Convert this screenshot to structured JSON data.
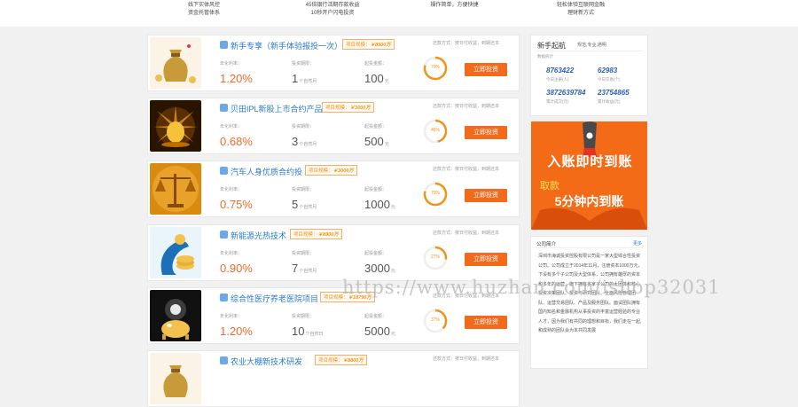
{
  "features": [
    {
      "line1": "线下实体风控",
      "line2": "资金托管体系"
    },
    {
      "line1": "45倍银行活期存款收益",
      "line2": "10秒开户闪电投资"
    },
    {
      "line1": "操作简单，方便快捷",
      "line2": ""
    },
    {
      "line1": "轻松体验互联网金融",
      "line2": "理财新方式"
    }
  ],
  "labels": {
    "annual_rate": "年化利率：",
    "term": "投资期限：",
    "amount": "起投金额：",
    "repay": "还款方式：按日付收益，到期还本",
    "invest_button": "立即投资",
    "tag_prefix": "项目规模："
  },
  "products": [
    {
      "name": "新手专享（新手体验报投一次）",
      "scale": "￥8500万",
      "rate": "1.20%",
      "term": "1",
      "term_unit": "个自然月",
      "amount": "100",
      "amount_unit": "元",
      "progress": "79%",
      "progress_value": 0.79,
      "image": "money-bag-icon"
    },
    {
      "name": "贝田IPL新股上市合约产品",
      "scale": "￥3000万",
      "rate": "0.68%",
      "term": "3",
      "term_unit": "个自然月",
      "amount": "500",
      "amount_unit": "元",
      "progress": "46%",
      "progress_value": 0.46,
      "image": "golden-egg-icon"
    },
    {
      "name": "汽车人身优质合约投",
      "scale": "￥3000万",
      "rate": "0.75%",
      "term": "5",
      "term_unit": "个自然月",
      "amount": "1000",
      "amount_unit": "元",
      "progress": "79%",
      "progress_value": 0.79,
      "image": "scale-icon"
    },
    {
      "name": "新能源光热技术",
      "scale": "￥8900万",
      "rate": "0.90%",
      "term": "7",
      "term_unit": "个自然月",
      "amount": "3000",
      "amount_unit": "元",
      "progress": "27%",
      "progress_value": 0.27,
      "image": "coin-figure-icon"
    },
    {
      "name": "综合性医疗养老医院项目",
      "scale": "￥18790万",
      "rate": "1.20%",
      "term": "10",
      "term_unit": "个自然日",
      "amount": "5000",
      "amount_unit": "元",
      "progress": "37%",
      "progress_value": 0.37,
      "image": "piggy-figure-icon"
    },
    {
      "name": "农业大棚新技术研发",
      "scale": "￥8800万",
      "rate": "",
      "term": "",
      "term_unit": "",
      "amount": "",
      "amount_unit": "",
      "progress": "",
      "progress_value": 0,
      "image": "money-bag-icon"
    }
  ],
  "sidebar": {
    "title": "新手起航",
    "subtitle": "规范,专业,通明",
    "stats_title": "数据统计",
    "stats": [
      {
        "value": "8763422",
        "label": "今日注册(人)"
      },
      {
        "value": "62983",
        "label": "今日交易(个)"
      },
      {
        "value": "3872639784",
        "label": "累计成交(元)"
      },
      {
        "value": "23754865",
        "label": "累计收益(元)"
      }
    ]
  },
  "banner": {
    "line1": "入账即时到账",
    "line2": "取款",
    "line3": "5分钟内到账"
  },
  "about": {
    "title": "公司简介",
    "more": "更多",
    "text": "深圳市海诚投资控股有限公司是一家大型综合性投资公司。公司成立于2014年11月，注册资本1000万元，下设有多个子公司及大型体系，公司拥有雄厚的资本和多年的运营，旗下拥有多家子公司的大团体和核心投资决策团队、投资与研究团队、全面风险管理团队、运营交易团队、产品及服务团队。面试团队拥有国内知名和金融机构从事投资的丰富运营经验的专业人才，因为我们有共同的理想和目标，我们走在一起,和成熟的团队会为本共同发展"
  },
  "watermark": "https://www.huzhan.com/ishop32031",
  "colors": {
    "accent": "#f26b1d",
    "link": "#2c79c9",
    "rate": "#f26b2a"
  }
}
